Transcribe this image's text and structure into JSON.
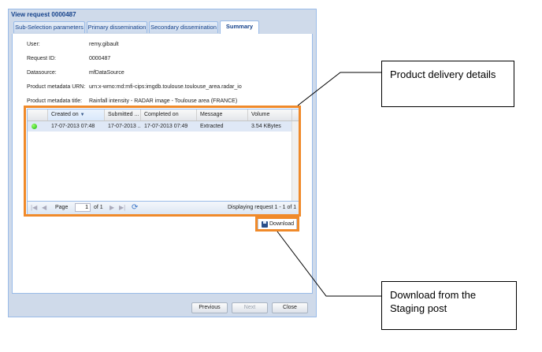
{
  "window": {
    "title": "View request 0000487"
  },
  "tabs": [
    {
      "label": "Sub-Selection parameters",
      "active": false
    },
    {
      "label": "Primary dissemination",
      "active": false
    },
    {
      "label": "Secondary dissemination",
      "active": false
    },
    {
      "label": "Summary",
      "active": true
    }
  ],
  "fields": [
    {
      "label": "User:",
      "value": "remy.gibault"
    },
    {
      "label": "Request ID:",
      "value": "0000487"
    },
    {
      "label": "Datasource:",
      "value": "mfDataSource"
    },
    {
      "label": "Product metadata URN:",
      "value": "urn:x-wmo:md:mfi-cips:imgdb.toulouse.toulouse_area.radar_io"
    },
    {
      "label": "Product metadata title:",
      "value": "Rainfall intensity - RADAR image - Toulouse area (FRANCE)"
    }
  ],
  "grid": {
    "columns": [
      "Created on",
      "Submitted ...",
      "Completed on",
      "Message",
      "Volume"
    ],
    "sorted_column": "Created on",
    "rows": [
      {
        "status": "green",
        "created_on": "17-07-2013 07:48",
        "submitted": "17-07-2013 ...",
        "completed_on": "17-07-2013 07:49",
        "message": "Extracted",
        "volume": "3.54 KBytes"
      }
    ],
    "pager": {
      "page_label": "Page",
      "page_value": "1",
      "of_label": "of 1",
      "display": "Displaying request 1 - 1 of 1"
    }
  },
  "download_label": "Download",
  "footer": {
    "previous": "Previous",
    "next": "Next",
    "close": "Close"
  },
  "callouts": {
    "product_delivery": "Product delivery details",
    "download_staging": "Download from the Staging post"
  },
  "colors": {
    "highlight": "#f08a2a",
    "header_text": "#15428b",
    "selected_row": "#dfe8f6",
    "window_bg": "#cfdaea"
  }
}
